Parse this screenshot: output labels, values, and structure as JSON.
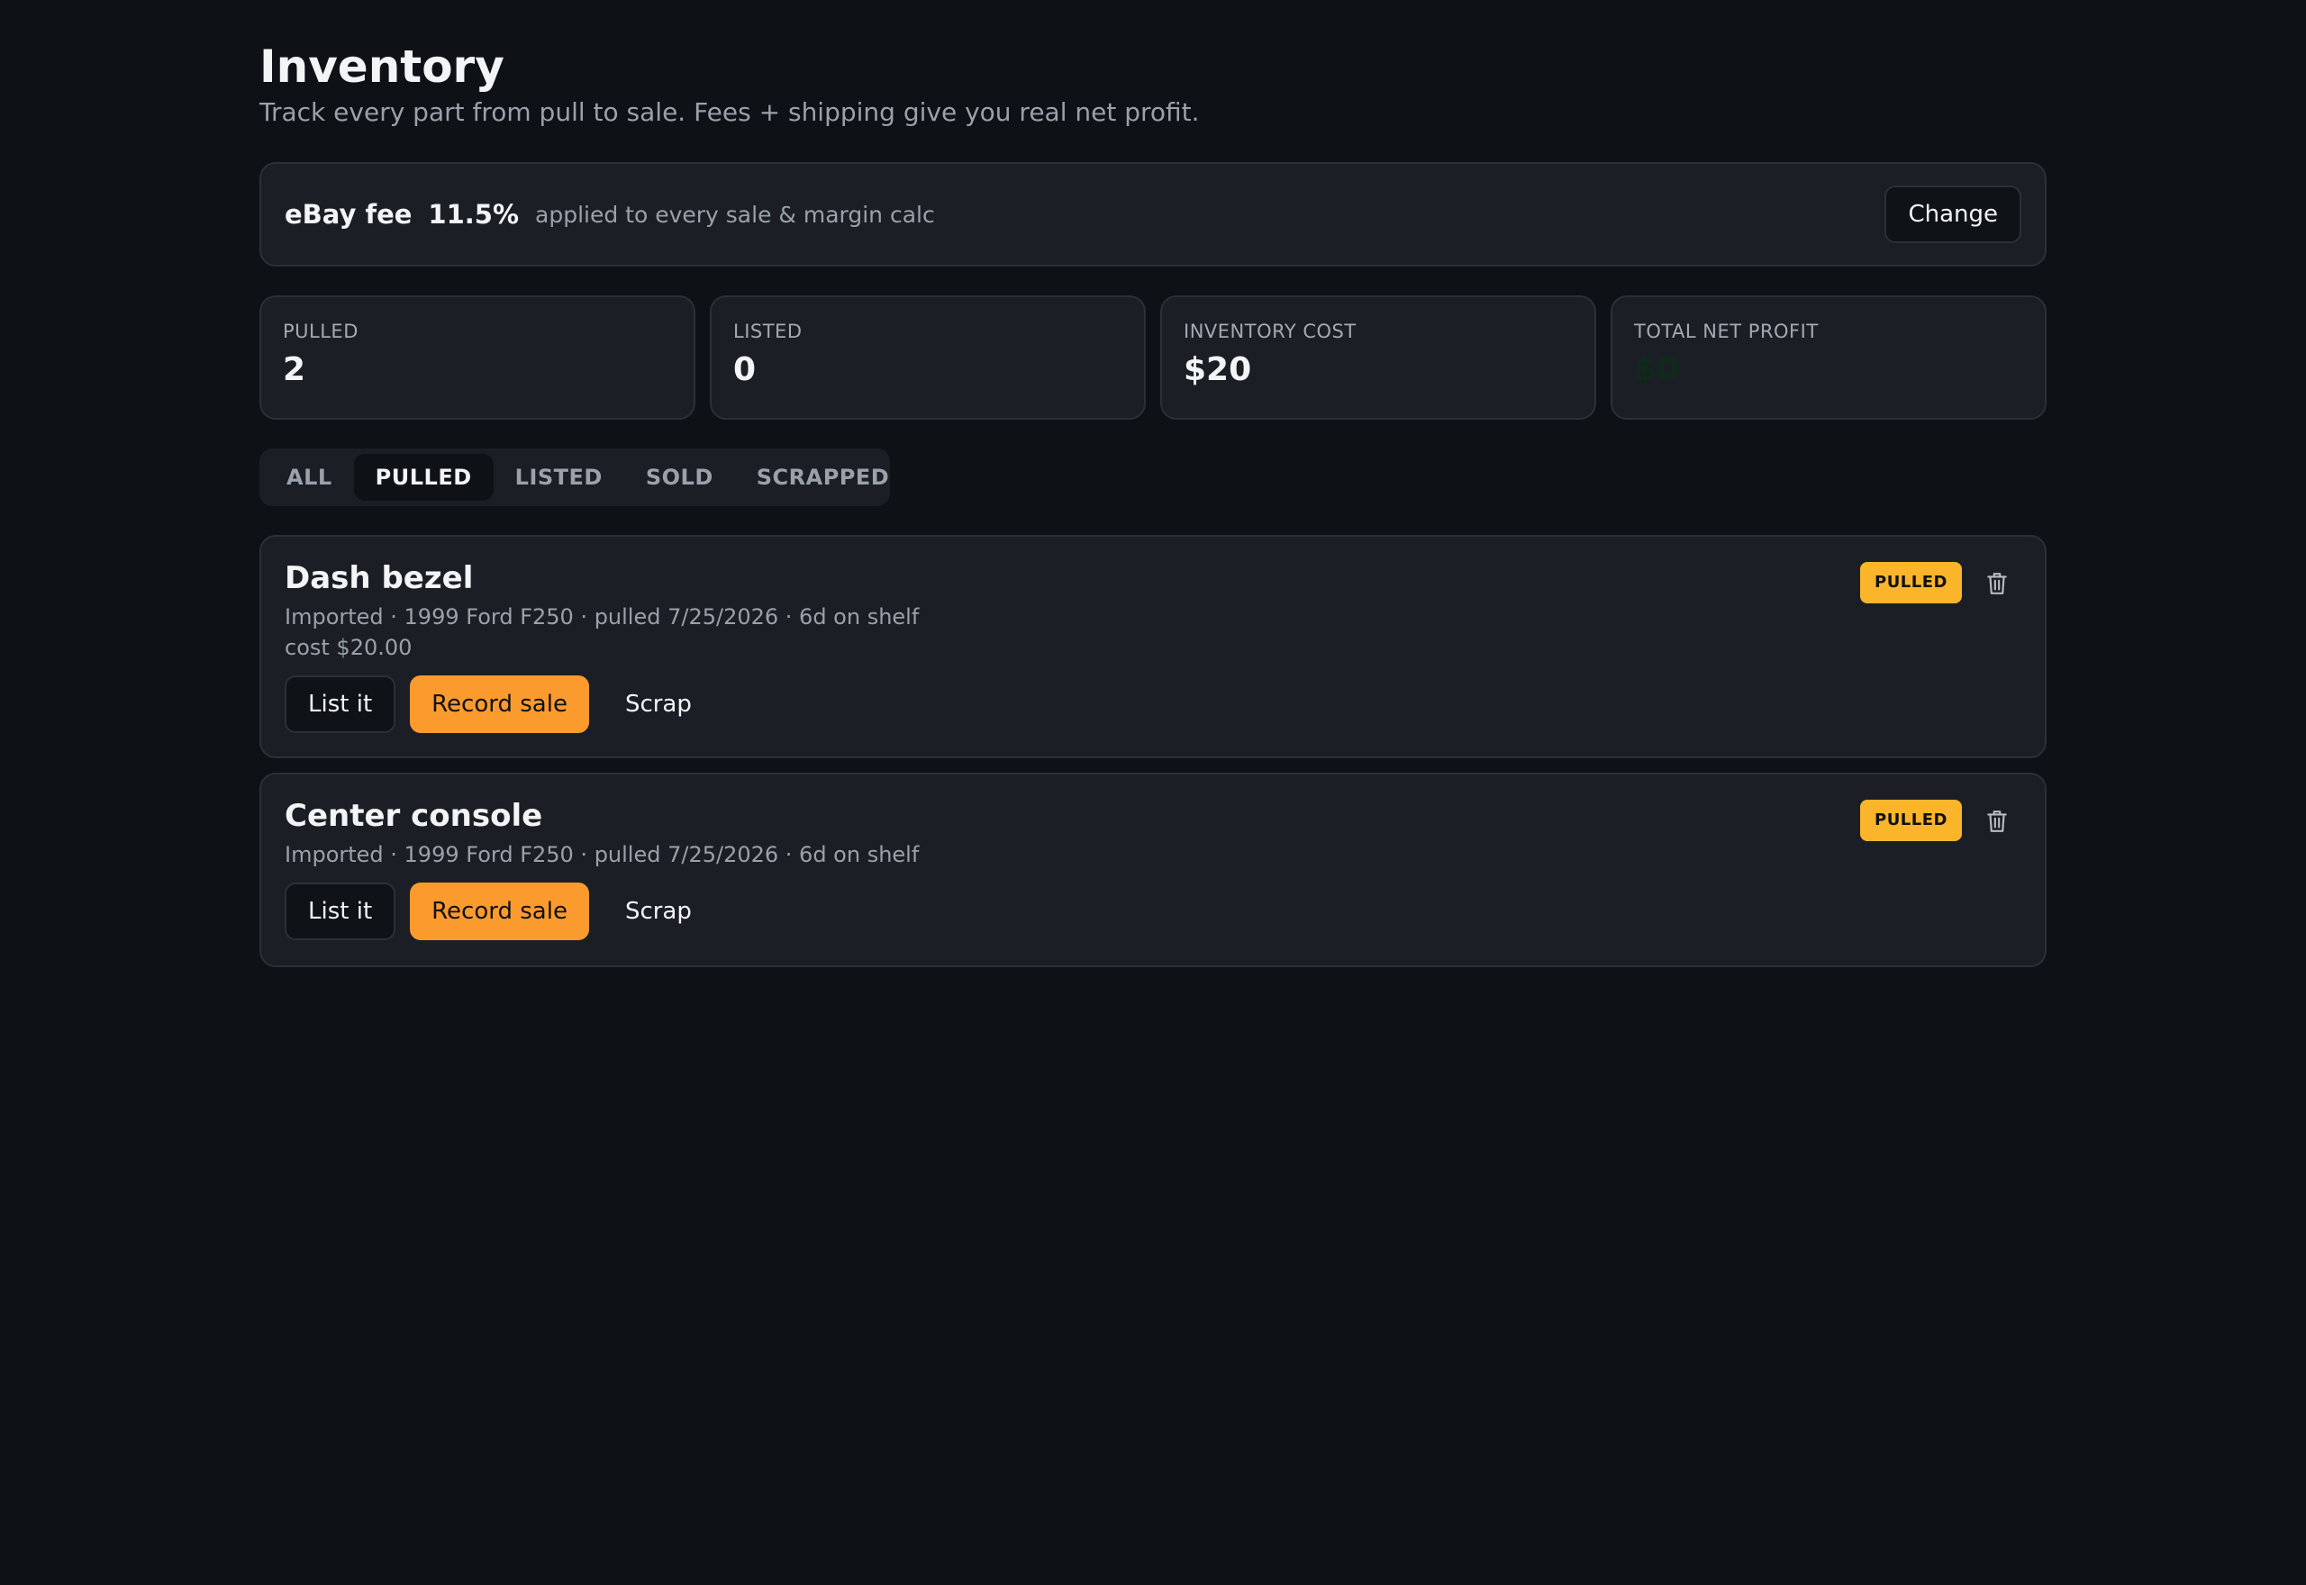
{
  "header": {
    "title": "Inventory",
    "subtitle": "Track every part from pull to sale. Fees + shipping give you real net profit."
  },
  "fee": {
    "label": "eBay fee",
    "value": "11.5%",
    "note": "applied to every sale & margin calc",
    "change_label": "Change"
  },
  "stats": [
    {
      "label": "PULLED",
      "value": "2"
    },
    {
      "label": "LISTED",
      "value": "0"
    },
    {
      "label": "INVENTORY COST",
      "value": "$20"
    },
    {
      "label": "TOTAL NET PROFIT",
      "value": "$0"
    }
  ],
  "tabs": [
    {
      "label": "ALL"
    },
    {
      "label": "PULLED",
      "active": true
    },
    {
      "label": "LISTED"
    },
    {
      "label": "SOLD"
    },
    {
      "label": "SCRAPPED"
    }
  ],
  "items": [
    {
      "name": "Dash bezel",
      "meta": "Imported · 1999 Ford F250 · pulled 7/25/2026 · 6d on shelf",
      "cost": "cost $20.00",
      "badge": "PULLED",
      "list_label": "List it",
      "sale_label": "Record sale",
      "scrap_label": "Scrap"
    },
    {
      "name": "Center console",
      "meta": "Imported · 1999 Ford F250 · pulled 7/25/2026 · 6d on shelf",
      "badge": "PULLED",
      "list_label": "List it",
      "sale_label": "Record sale",
      "scrap_label": "Scrap"
    }
  ],
  "icons": {
    "delete": "trash-icon"
  },
  "colors": {
    "accent": "#fb9b2e",
    "badge": "#fbb52a",
    "background": "#0e1116",
    "panel": "#1b1f25"
  }
}
